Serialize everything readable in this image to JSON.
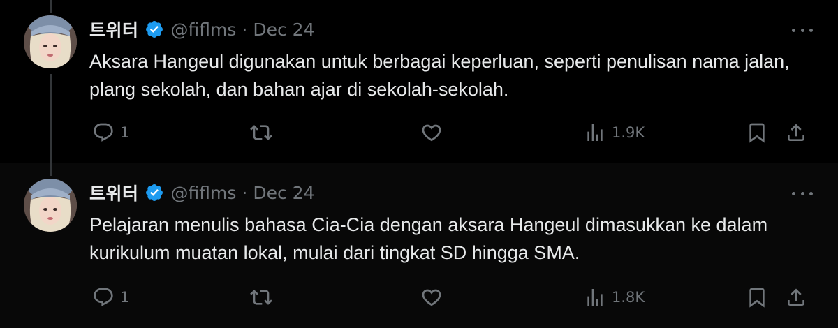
{
  "tweets": [
    {
      "display_name": "트위터",
      "handle": "@fiflms",
      "separator": "·",
      "date": "Dec 24",
      "text": "Aksara Hangeul digunakan untuk berbagai keperluan, seperti penulisan nama jalan, plang sekolah, dan bahan ajar di sekolah-sekolah.",
      "replies": "1",
      "views": "1.9K"
    },
    {
      "display_name": "트위터",
      "handle": "@fiflms",
      "separator": "·",
      "date": "Dec 24",
      "text": "Pelajaran menulis bahasa Cia-Cia dengan aksara Hangeul dimasukkan ke dalam kurikulum muatan lokal, mulai dari tingkat SD hingga SMA.",
      "replies": "1",
      "views": "1.8K"
    }
  ],
  "colors": {
    "background": "#000000",
    "text": "#e7e9ea",
    "muted": "#71767b",
    "verified": "#1d9bf0"
  },
  "icons": [
    "verified-badge-icon",
    "more-icon",
    "reply-icon",
    "retweet-icon",
    "like-icon",
    "views-icon",
    "bookmark-icon",
    "share-icon"
  ]
}
